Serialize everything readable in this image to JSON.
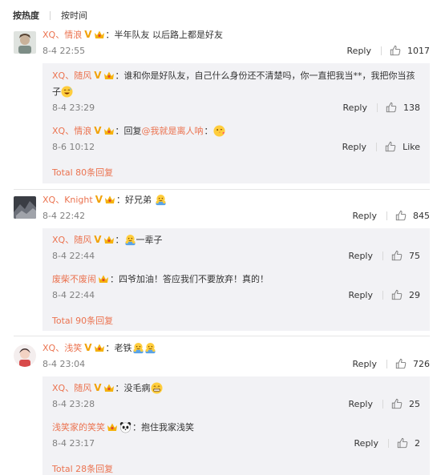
{
  "sort": {
    "hot": "按热度",
    "time": "按时间"
  },
  "labels": {
    "reply": "Reply",
    "colon": "："
  },
  "comments": [
    {
      "user": "XQ、情浪",
      "text": "半年队友 以后路上都是好友",
      "time": "8-4 22:55",
      "likes": "1017",
      "replies": [
        {
          "user": "XQ、随风",
          "text": "谁和你是好队友，自己什么身份还不清楚吗，你一直把我当**，我把你当孩",
          "text2": "子",
          "time": "8-4 23:29",
          "likes": "138"
        },
        {
          "user": "XQ、情浪",
          "text_prefix": "回复",
          "mention": "@我就是离人呐",
          "time": "8-6 10:12",
          "likes": "Like"
        }
      ],
      "total": "Total 80条回复"
    },
    {
      "user": "XQ、Knight",
      "text": "好兄弟",
      "time": "8-4 22:42",
      "likes": "845",
      "replies": [
        {
          "user": "XQ、随风",
          "text": "一辈子",
          "time": "8-4 22:44",
          "likes": "75"
        },
        {
          "user": "废柴不废闹",
          "text": "四爷加油！答应我们不要放弃！真的！",
          "time": "8-4 22:44",
          "likes": "29"
        }
      ],
      "total": "Total 90条回复"
    },
    {
      "user": "XQ、浅笑",
      "text": "老铁",
      "time": "8-4 23:04",
      "likes": "726",
      "replies": [
        {
          "user": "XQ、随风",
          "text": "没毛病",
          "time": "8-4 23:28",
          "likes": "25"
        },
        {
          "user": "浅笑家的笑笑",
          "text": "抱住我家浅笑",
          "time": "8-4 23:17",
          "likes": "2"
        }
      ],
      "total": "Total 28条回复"
    }
  ],
  "colors": {
    "accent": "#eb7350",
    "vip": "#f1a30a",
    "reply_bg": "#f2f2f5"
  }
}
